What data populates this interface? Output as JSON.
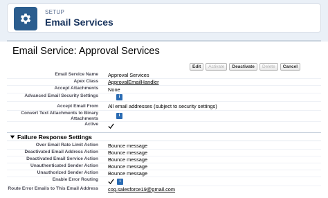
{
  "header": {
    "setup_label": "SETUP",
    "title": "Email Services",
    "icon": "gear-icon"
  },
  "page": {
    "title": "Email Service: Approval Services"
  },
  "buttons": {
    "edit": "Edit",
    "activate": "Activate",
    "deactivate": "Deactivate",
    "delete": "Delete",
    "cancel": "Cancel"
  },
  "details": [
    {
      "label": "Email Service Name",
      "value": "Approval Services"
    },
    {
      "label": "Apex Class",
      "value": "ApprovalEmailHandler"
    },
    {
      "label": "Accept Attachments",
      "value": "None"
    },
    {
      "label": "Advanced Email Security Settings",
      "value": ""
    },
    {
      "label": "Accept Email From",
      "value": "All email addresses (subject to security settings)"
    },
    {
      "label": "Convert Text Attachments to Binary Attachments",
      "value": ""
    },
    {
      "label": "Active",
      "value": ""
    }
  ],
  "failure_section": {
    "title": "Failure Response Settings",
    "rows": [
      {
        "label": "Over Email Rate Limit Action",
        "value": "Bounce message"
      },
      {
        "label": "Deactivated Email Address Action",
        "value": "Bounce message"
      },
      {
        "label": "Deactivated Email Service Action",
        "value": "Bounce message"
      },
      {
        "label": "Unauthenticated Sender Action",
        "value": "Bounce message"
      },
      {
        "label": "Unauthorized Sender Action",
        "value": "Bounce message"
      },
      {
        "label": "Enable Error Routing",
        "value": ""
      },
      {
        "label": "Route Error Emails to This Email Address",
        "value": "cog.salesforce19@gmail.com"
      }
    ]
  },
  "colors": {
    "accent": "#2b5d8e",
    "info": "#2b6cb3"
  }
}
